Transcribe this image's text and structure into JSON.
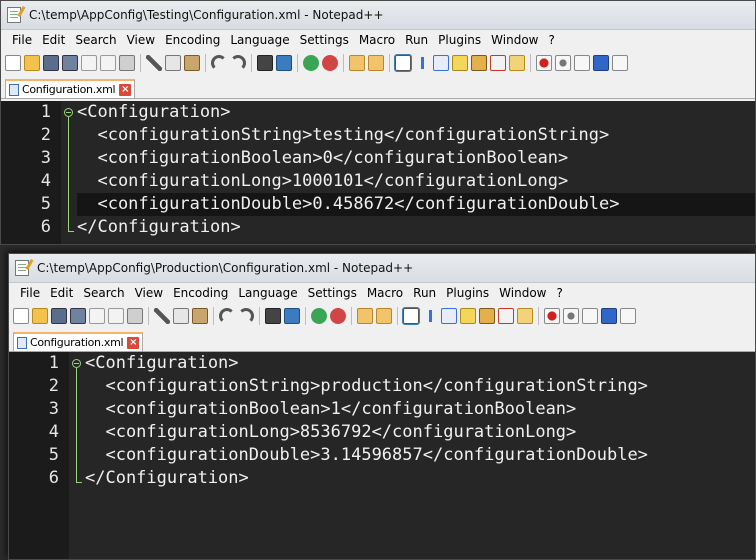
{
  "windows": [
    {
      "title": "C:\\temp\\AppConfig\\Testing\\Configuration.xml - Notepad++",
      "tab_label": "Configuration.xml",
      "lines": [
        {
          "num": "1",
          "text": "<Configuration>"
        },
        {
          "num": "2",
          "text": "  <configurationString>testing</configurationString>"
        },
        {
          "num": "3",
          "text": "  <configurationBoolean>0</configurationBoolean>"
        },
        {
          "num": "4",
          "text": "  <configurationLong>1000101</configurationLong>"
        },
        {
          "num": "5",
          "text": "  <configurationDouble>0.458672</configurationDouble>"
        },
        {
          "num": "6",
          "text": "</Configuration>"
        }
      ]
    },
    {
      "title": "C:\\temp\\AppConfig\\Production\\Configuration.xml - Notepad++",
      "tab_label": "Configuration.xml",
      "lines": [
        {
          "num": "1",
          "text": "<Configuration>"
        },
        {
          "num": "2",
          "text": "  <configurationString>production</configurationString>"
        },
        {
          "num": "3",
          "text": "  <configurationBoolean>1</configurationBoolean>"
        },
        {
          "num": "4",
          "text": "  <configurationLong>8536792</configurationLong>"
        },
        {
          "num": "5",
          "text": "  <configurationDouble>3.14596857</configurationDouble>"
        },
        {
          "num": "6",
          "text": "</Configuration>"
        }
      ]
    }
  ],
  "menu": [
    "File",
    "Edit",
    "Search",
    "View",
    "Encoding",
    "Language",
    "Settings",
    "Macro",
    "Run",
    "Plugins",
    "Window",
    "?"
  ],
  "tab_close_glyph": "×",
  "toolbar_icons": [
    "new-file-icon",
    "open-file-icon",
    "save-icon",
    "save-all-icon",
    "close-icon",
    "close-all-icon",
    "print-icon",
    "cut-icon",
    "copy-icon",
    "paste-icon",
    "undo-icon",
    "redo-icon",
    "find-icon",
    "replace-icon",
    "zoom-in-icon",
    "zoom-out-icon",
    "sync-vertical-icon",
    "sync-horizontal-icon",
    "word-wrap-icon",
    "show-all-chars-icon",
    "indent-guide-icon",
    "user-language-icon",
    "doc-map-icon",
    "function-list-icon",
    "folder-workspace-icon",
    "record-macro-icon",
    "stop-record-icon",
    "play-macro-icon",
    "run-macro-multiple-icon",
    "save-macro-icon"
  ],
  "colors": {
    "editor_bg": "#262626",
    "gutter_bg": "#1b1b1b",
    "fold_marker": "#9bd37a",
    "tab_accent": "#f6b26b"
  }
}
